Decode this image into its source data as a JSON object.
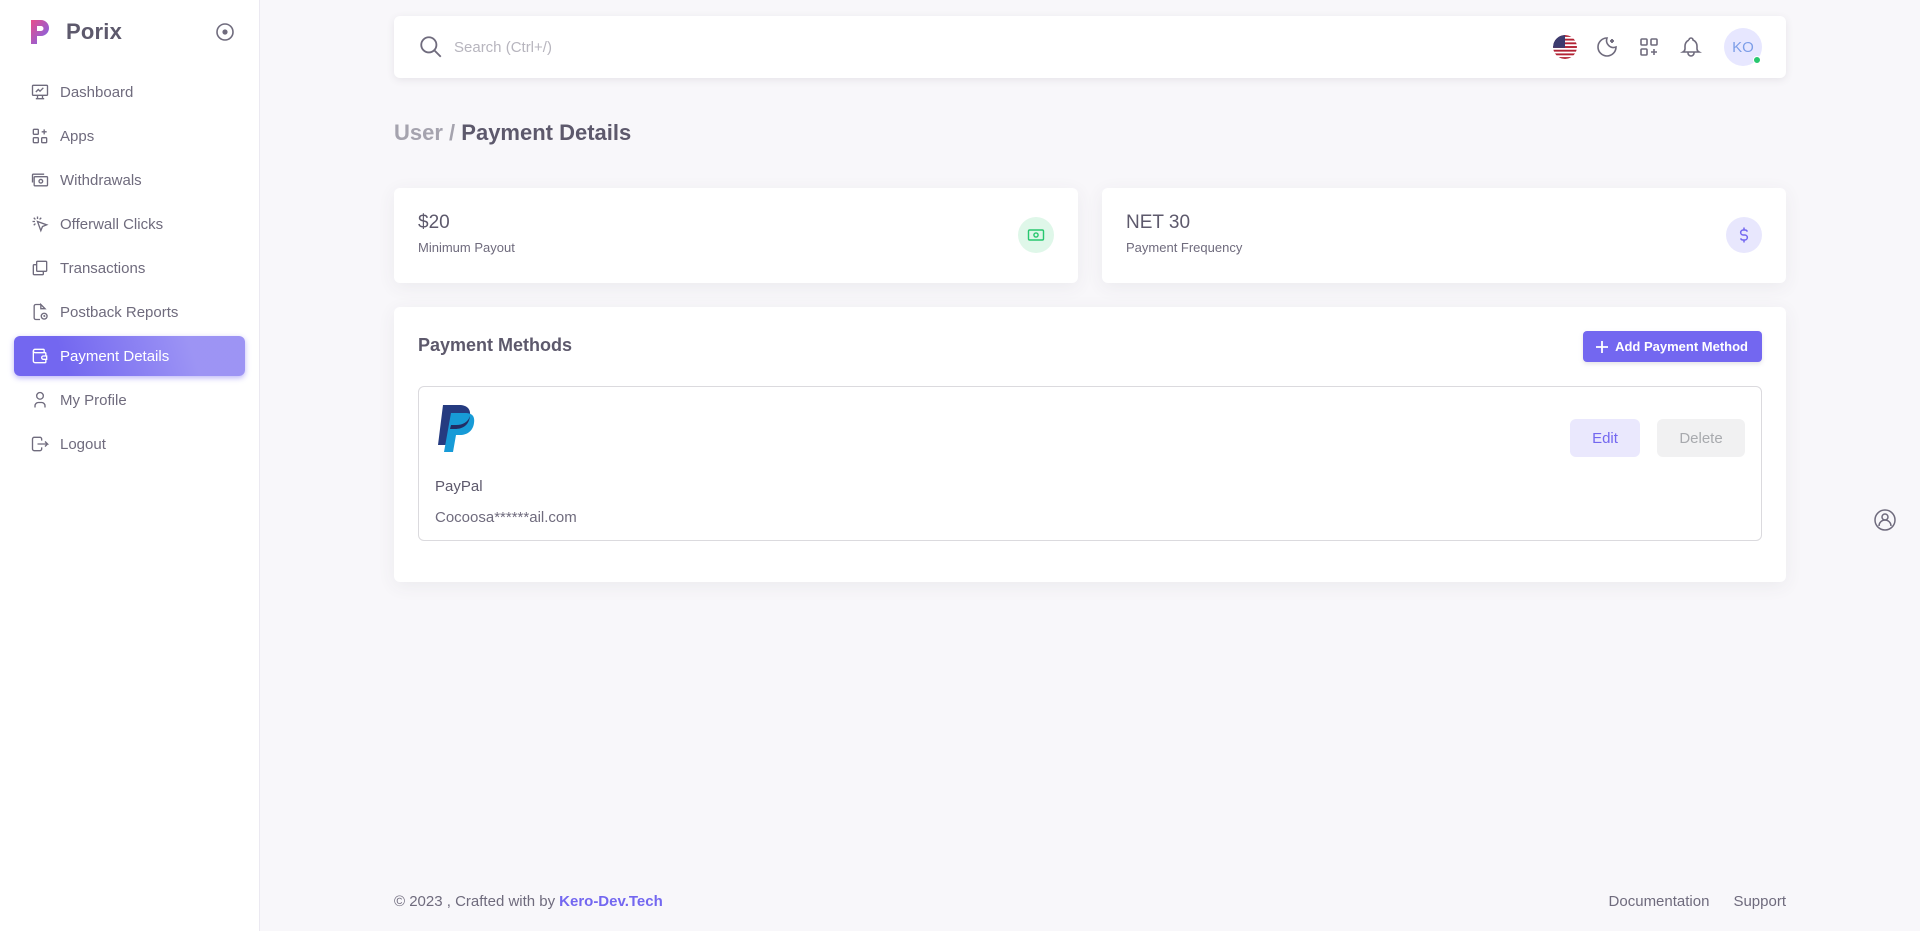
{
  "brand": {
    "name": "Porix"
  },
  "sidebar": {
    "items": [
      {
        "label": "Dashboard",
        "icon": "dashboard-icon"
      },
      {
        "label": "Apps",
        "icon": "apps-icon"
      },
      {
        "label": "Withdrawals",
        "icon": "withdrawals-icon"
      },
      {
        "label": "Offerwall Clicks",
        "icon": "offerwall-clicks-icon"
      },
      {
        "label": "Transactions",
        "icon": "transactions-icon"
      },
      {
        "label": "Postback Reports",
        "icon": "postback-reports-icon"
      },
      {
        "label": "Payment Details",
        "icon": "payment-details-icon",
        "active": true
      },
      {
        "label": "My Profile",
        "icon": "user-icon"
      },
      {
        "label": "Logout",
        "icon": "logout-icon"
      }
    ]
  },
  "navbar": {
    "search_placeholder": "Search (Ctrl+/)",
    "avatar_initials": "KO"
  },
  "page": {
    "breadcrumb": "User /",
    "title": "Payment Details"
  },
  "stats": {
    "payout_value": "$20",
    "payout_label": "Minimum Payout",
    "frequency_value": "NET 30",
    "frequency_label": "Payment Frequency"
  },
  "methods": {
    "title": "Payment Methods",
    "add_label": "Add Payment Method",
    "items": [
      {
        "name": "PayPal",
        "email": "Cocoosa******ail.com",
        "edit_label": "Edit",
        "delete_label": "Delete"
      }
    ]
  },
  "footer": {
    "copyright": "© 2023 , Crafted with by",
    "brand_link": "Kero-Dev.Tech",
    "documentation": "Documentation",
    "support": "Support"
  },
  "colors": {
    "primary": "#7367f0",
    "success": "#28c76f",
    "background": "#f8f7fa"
  }
}
